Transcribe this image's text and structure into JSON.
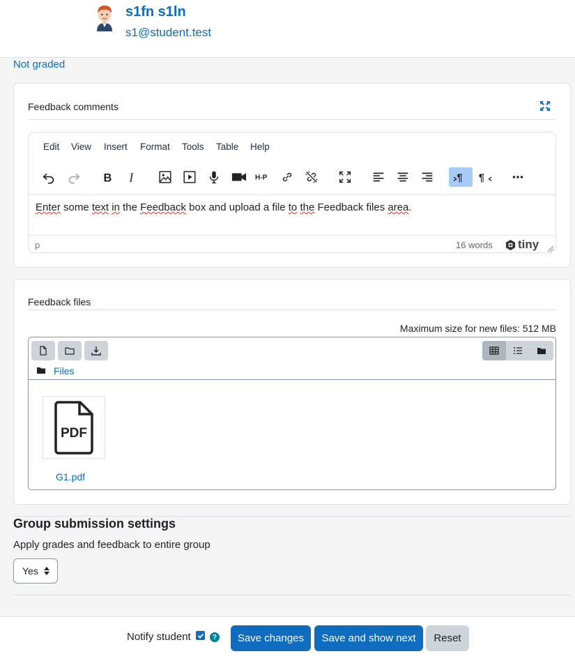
{
  "user": {
    "name": "s1fn s1ln",
    "email": "s1@student.test"
  },
  "grade_status": "Not graded",
  "feedback_comments": {
    "label": "Feedback comments",
    "menu": [
      "Edit",
      "View",
      "Insert",
      "Format",
      "Tools",
      "Table",
      "Help"
    ],
    "content_segments": [
      {
        "text": "Enter",
        "spell": true
      },
      {
        "text": " some ",
        "spell": false
      },
      {
        "text": "text",
        "spell": true
      },
      {
        "text": " ",
        "spell": false
      },
      {
        "text": "in",
        "spell": true
      },
      {
        "text": " the ",
        "spell": false
      },
      {
        "text": "Feedback",
        "spell": true
      },
      {
        "text": " box and upload a file ",
        "spell": false
      },
      {
        "text": "to",
        "spell": true
      },
      {
        "text": " ",
        "spell": false
      },
      {
        "text": "the",
        "spell": true
      },
      {
        "text": " Feedback files ",
        "spell": false
      },
      {
        "text": "area",
        "spell": true
      },
      {
        "text": ".",
        "spell": false
      }
    ],
    "status_path": "p",
    "word_count": "16 words",
    "brand": "tiny"
  },
  "feedback_files": {
    "label": "Feedback files",
    "max_size": "Maximum size for new files: 512 MB",
    "breadcrumb": "Files",
    "files": [
      {
        "name": "G1.pdf",
        "icon_text": "PDF"
      }
    ]
  },
  "group_settings": {
    "title": "Group submission settings",
    "apply_label": "Apply grades and feedback to entire group",
    "apply_value": "Yes"
  },
  "footer": {
    "notify_label": "Notify student",
    "notify_checked": true,
    "help": "?",
    "save": "Save changes",
    "save_next": "Save and show next",
    "reset": "Reset"
  },
  "colors": {
    "primary": "#0f6cbf",
    "secondary": "#ced4da",
    "help": "#008196"
  }
}
